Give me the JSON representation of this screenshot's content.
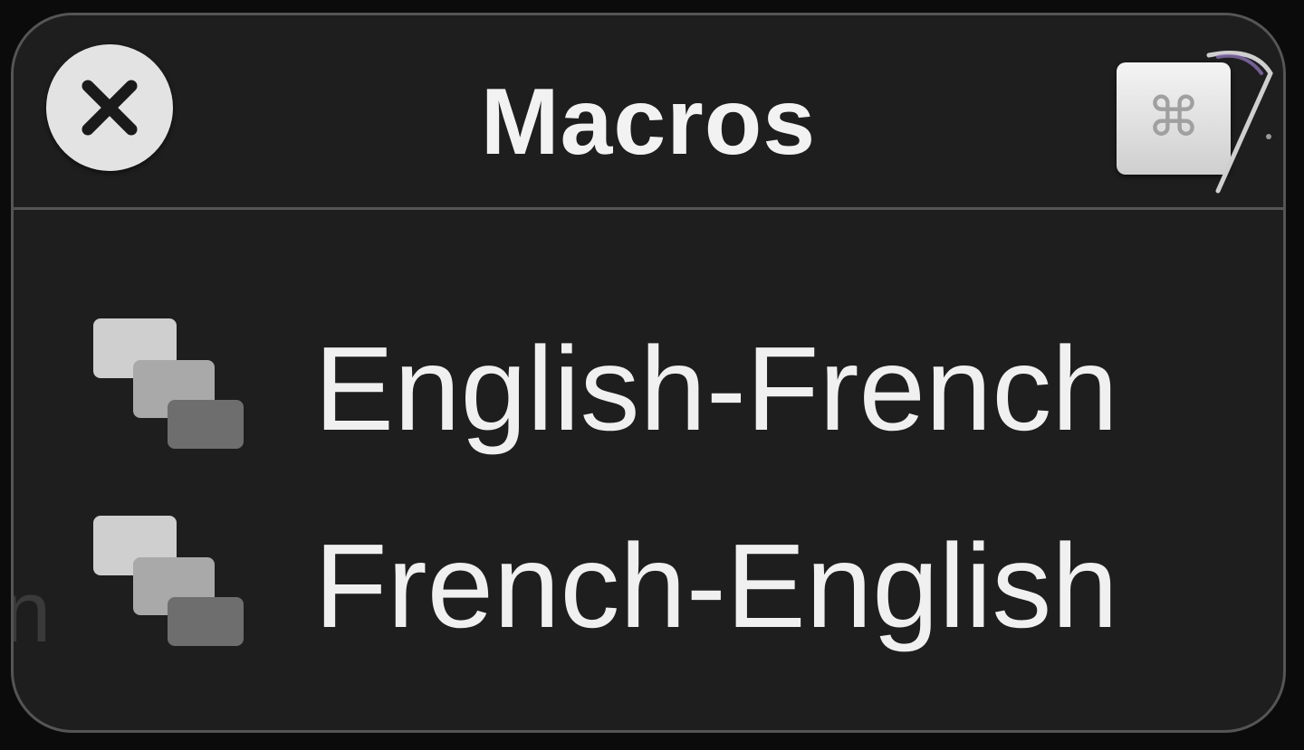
{
  "window": {
    "title": "Macros"
  },
  "header": {
    "close_icon": "close-icon",
    "shortcut_icon": "command-key-icon",
    "shortcut_glyph": "⌘"
  },
  "macros": [
    {
      "label": "English-French",
      "icon": "macro-group-icon"
    },
    {
      "label": "French-English",
      "icon": "macro-group-icon"
    }
  ],
  "background": {
    "ghost_text": "n"
  },
  "colors": {
    "panel_bg": "#1e1e1e",
    "panel_border": "#555555",
    "text": "#f0f0f0",
    "button_bg": "#e3e3e3"
  }
}
